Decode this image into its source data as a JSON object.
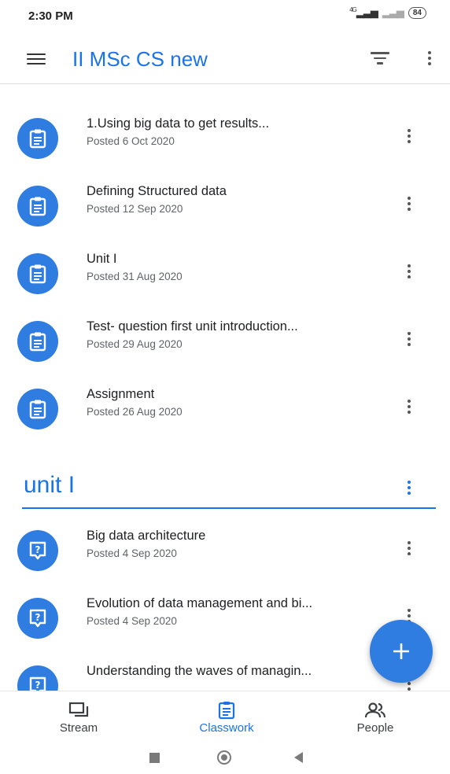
{
  "status_bar": {
    "time": "2:30 PM",
    "network": "4G",
    "battery": "84"
  },
  "app_bar": {
    "title": "II MSc CS new"
  },
  "assignments": [
    {
      "title": "1.Using big data to get results...",
      "posted": "Posted 6 Oct 2020",
      "icon": "assignment-icon"
    },
    {
      "title": "Defining Structured data",
      "posted": "Posted 12 Sep 2020",
      "icon": "assignment-icon"
    },
    {
      "title": "Unit I",
      "posted": "Posted 31 Aug 2020",
      "icon": "assignment-icon"
    },
    {
      "title": "Test- question  first unit introduction...",
      "posted": "Posted 29 Aug 2020",
      "icon": "assignment-icon"
    },
    {
      "title": "Assignment",
      "posted": "Posted 26 Aug 2020",
      "icon": "assignment-icon"
    }
  ],
  "topic": {
    "title": "unit I",
    "items": [
      {
        "title": "Big data architecture",
        "posted": "Posted 4 Sep 2020",
        "icon": "question-icon"
      },
      {
        "title": "Evolution of data management and bi...",
        "posted": "Posted 4 Sep 2020",
        "icon": "question-icon"
      },
      {
        "title": "Understanding the waves of managin...",
        "posted": "",
        "icon": "question-icon"
      }
    ]
  },
  "bottom_nav": {
    "tabs": [
      {
        "label": "Stream",
        "icon": "stream-icon"
      },
      {
        "label": "Classwork",
        "icon": "classwork-icon",
        "active": true
      },
      {
        "label": "People",
        "icon": "people-icon"
      }
    ]
  },
  "colors": {
    "accent": "#1a73e8",
    "icon_bg": "#2f7de1"
  }
}
